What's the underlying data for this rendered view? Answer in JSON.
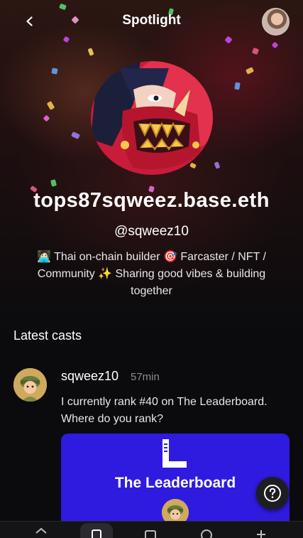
{
  "header": {
    "title": "Spotlight",
    "back_icon": "chevron-left-icon",
    "account_avatar": "user-avatar"
  },
  "profile": {
    "ens_name": "tops87sqweez.base.eth",
    "username": "@sqweez10",
    "bio": "🧑🏻‍💻 Thai on-chain builder 🎯 Farcaster / NFT / Community ✨ Sharing good vibes & building together"
  },
  "latest_casts": {
    "section_title": "Latest casts",
    "items": [
      {
        "author": "sqweez10",
        "time": "57min",
        "text": "I currently rank #40 on The Leaderboard. Where do you rank?",
        "embed": {
          "logo_letter": "L",
          "title": "The Leaderboard"
        }
      }
    ]
  },
  "help_button": {
    "icon": "question-circle-icon"
  },
  "bottom_nav": {
    "items": [
      {
        "icon": "home-icon"
      },
      {
        "icon": "explore-icon",
        "active": true
      },
      {
        "icon": "messages-icon"
      },
      {
        "icon": "notifications-icon"
      },
      {
        "icon": "add-icon"
      }
    ]
  },
  "colors": {
    "background": "#0b0b0d",
    "embed_card": "#2f1ae0",
    "muted_text": "#8b8b90"
  }
}
